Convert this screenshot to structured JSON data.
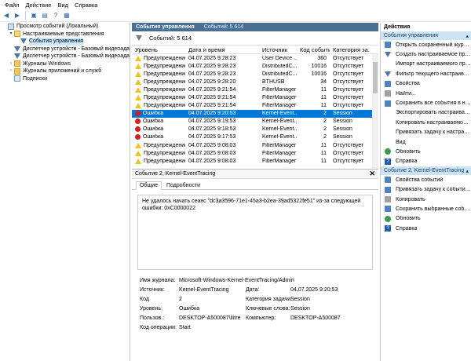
{
  "menu": [
    "Файл",
    "Действие",
    "Вид",
    "Справка"
  ],
  "tree": [
    {
      "label": "Просмотр событий (Локальный)",
      "indent": 0,
      "icon": "pc",
      "arrow": ""
    },
    {
      "label": "Настраиваемые представления",
      "indent": 1,
      "icon": "folder-open",
      "arrow": "▾"
    },
    {
      "label": "События управления",
      "indent": 2,
      "icon": "filter",
      "arrow": "",
      "selected": true
    },
    {
      "label": "Диспетчер устройств - Базовый видеоадаптер (Ма",
      "indent": 2,
      "icon": "filter",
      "arrow": ""
    },
    {
      "label": "Диспетчер устройств - Базовый видеоадаптер (Ма",
      "indent": 2,
      "icon": "filter",
      "arrow": ""
    },
    {
      "label": "Журналы Windows",
      "indent": 1,
      "icon": "folder",
      "arrow": "›"
    },
    {
      "label": "Журналы приложений и служб",
      "indent": 1,
      "icon": "folder",
      "arrow": "›"
    },
    {
      "label": "Подписки",
      "indent": 1,
      "icon": "log",
      "arrow": ""
    }
  ],
  "center": {
    "title": "События управления",
    "subtitle": "Событий: 5 614",
    "count": "Событий: 5 614",
    "columns": [
      "Уровень",
      "Дата и время",
      "Источник",
      "Код события",
      "Категория за..."
    ],
    "rows": [
      {
        "level": "warn",
        "level_text": "Предупреждение",
        "date": "04.07.2025 9:28:23",
        "source": "User Device ...",
        "code": "360",
        "cat": "Отсутствует"
      },
      {
        "level": "warn",
        "level_text": "Предупреждение",
        "date": "04.07.2025 9:28:23",
        "source": "DistributedC...",
        "code": "10016",
        "cat": "Отсутствует"
      },
      {
        "level": "warn",
        "level_text": "Предупреждение",
        "date": "04.07.2025 9:28:23",
        "source": "DistributedC...",
        "code": "10016",
        "cat": "Отсутствует"
      },
      {
        "level": "warn",
        "level_text": "Предупреждение",
        "date": "04.07.2025 9:28:20",
        "source": "BTHUSB",
        "code": "34",
        "cat": "Отсутствует"
      },
      {
        "level": "warn",
        "level_text": "Предупреждение",
        "date": "04.07.2025 9:21:54",
        "source": "FilterManager",
        "code": "11",
        "cat": "Отсутствует"
      },
      {
        "level": "warn",
        "level_text": "Предупреждение",
        "date": "04.07.2025 9:21:54",
        "source": "FilterManager",
        "code": "11",
        "cat": "Отсутствует"
      },
      {
        "level": "warn",
        "level_text": "Предупреждение",
        "date": "04.07.2025 9:21:54",
        "source": "FilterManager",
        "code": "11",
        "cat": "Отсутствует"
      },
      {
        "level": "err",
        "level_text": "Ошибка",
        "date": "04.07.2025 9:20:53",
        "source": "Kernel-Event...",
        "code": "2",
        "cat": "Session",
        "selected": true
      },
      {
        "level": "err",
        "level_text": "Ошибка",
        "date": "04.07.2025 9:19:53",
        "source": "Kernel-Event...",
        "code": "2",
        "cat": "Session"
      },
      {
        "level": "err",
        "level_text": "Ошибка",
        "date": "04.07.2025 9:18:53",
        "source": "Kernel-Event...",
        "code": "2",
        "cat": "Session"
      },
      {
        "level": "err",
        "level_text": "Ошибка",
        "date": "04.07.2025 9:17:53",
        "source": "Kernel-Event...",
        "code": "2",
        "cat": "Session"
      },
      {
        "level": "warn",
        "level_text": "Предупреждение",
        "date": "04.07.2025 9:08:03",
        "source": "FilterManager",
        "code": "11",
        "cat": "Отсутствует"
      },
      {
        "level": "warn",
        "level_text": "Предупреждение",
        "date": "04.07.2025 9:08:03",
        "source": "FilterManager",
        "code": "11",
        "cat": "Отсутствует"
      },
      {
        "level": "warn",
        "level_text": "Предупреждение",
        "date": "04.07.2025 9:08:03",
        "source": "FilterManager",
        "code": "11",
        "cat": "Отсутствует"
      }
    ]
  },
  "detail": {
    "title": "Событие 2, Kernel-EventTracing",
    "tabs": [
      "Общие",
      "Подробности"
    ],
    "message": "Не удалось начать сеанс \"dc3a3596-71e1-45a3-b2ea-39ad5322fe51\" из-за следующей ошибки: 0xC0000022",
    "props": {
      "log_label": "Имя журнала:",
      "log_value": "Microsoft-Windows-Kernel-EventTracing/Admin",
      "source_label": "Источник:",
      "source_value": "Kernel-EventTracing",
      "date_label": "Дата:",
      "date_value": "04.07.2025 9:20:53",
      "code_label": "Код",
      "code_value": "2",
      "task_label": "Категория задачи:",
      "task_value": "Session",
      "level_label": "Уровень:",
      "level_value": "Ошибка",
      "keywords_label": "Ключевые слова:",
      "keywords_value": "Session",
      "user_label": "Пользов.:",
      "user_value": "DESKTOP-A500087\\ilitre",
      "computer_label": "Компьютер:",
      "computer_value": "DESKTOP-A500087",
      "opcode_label": "Код операции:",
      "opcode_value": "Start"
    }
  },
  "actions": {
    "title": "Действия",
    "section1": "События управления",
    "items1": [
      {
        "label": "Открыть сохраненный журнал...",
        "icon": "blue"
      },
      {
        "label": "Создать настраиваемое предст...",
        "icon": "filter"
      },
      {
        "label": "Импорт настраиваемого предста...",
        "icon": "none"
      },
      {
        "label": "Фильтр текущего настраиваемо...",
        "icon": "filter"
      },
      {
        "label": "Свойства",
        "icon": "blue"
      },
      {
        "label": "Найти...",
        "icon": "grey"
      },
      {
        "label": "Сохранить все события в настра...",
        "icon": "blue"
      },
      {
        "label": "Экспортировать настраиваемое...",
        "icon": "none"
      },
      {
        "label": "Копировать настраиваемое пред...",
        "icon": "none"
      },
      {
        "label": "Привязать задачу к настраиваем...",
        "icon": "none"
      },
      {
        "label": "Вид",
        "icon": "none"
      },
      {
        "label": "Обновить",
        "icon": "green"
      },
      {
        "label": "Справка",
        "icon": "help"
      }
    ],
    "section2": "Событие 2, Kernel-EventTracing",
    "items2": [
      {
        "label": "Свойства событий",
        "icon": "blue"
      },
      {
        "label": "Привязать задачу к событию...",
        "icon": "blue"
      },
      {
        "label": "Копировать",
        "icon": "grey"
      },
      {
        "label": "Сохранить выбранные события...",
        "icon": "blue"
      },
      {
        "label": "Обновить",
        "icon": "green"
      },
      {
        "label": "Справка",
        "icon": "help"
      }
    ]
  }
}
